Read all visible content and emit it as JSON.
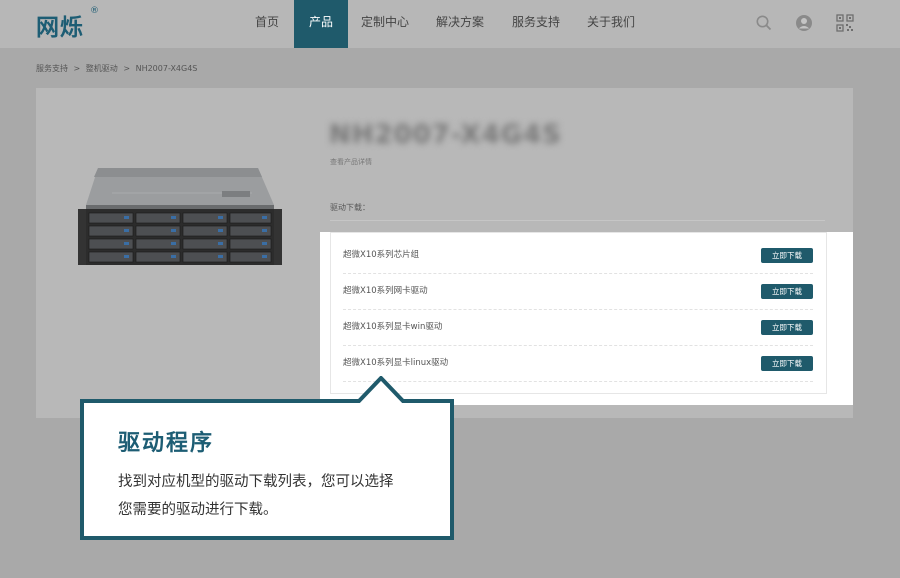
{
  "header": {
    "logo": "网烁",
    "logo_mark": "®",
    "nav": [
      {
        "label": "首页",
        "active": false
      },
      {
        "label": "产品",
        "active": true
      },
      {
        "label": "定制中心",
        "active": false
      },
      {
        "label": "解决方案",
        "active": false
      },
      {
        "label": "服务支持",
        "active": false
      },
      {
        "label": "关于我们",
        "active": false
      }
    ],
    "icons": [
      "search-icon",
      "user-icon",
      "qrcode-icon"
    ]
  },
  "breadcrumb": [
    "服务支持",
    ">",
    "整机驱动",
    ">",
    "NH2007-X4G4S"
  ],
  "product": {
    "title": "NH2007-X4G4S",
    "subtitle": "查看产品详情",
    "section_label": "驱动下载："
  },
  "downloads": [
    {
      "name": "超微X10系列芯片组",
      "button": "立即下载"
    },
    {
      "name": "超微X10系列网卡驱动",
      "button": "立即下载"
    },
    {
      "name": "超微X10系列显卡win驱动",
      "button": "立即下载"
    },
    {
      "name": "超微X10系列显卡linux驱动",
      "button": "立即下载"
    }
  ],
  "callout": {
    "title": "驱动程序",
    "line1": "找到对应机型的驱动下载列表，您可以选择",
    "line2": "您需要的驱动进行下载。"
  },
  "colors": {
    "brand": "#1f5a6b",
    "overlay": "#a9a9a9"
  }
}
